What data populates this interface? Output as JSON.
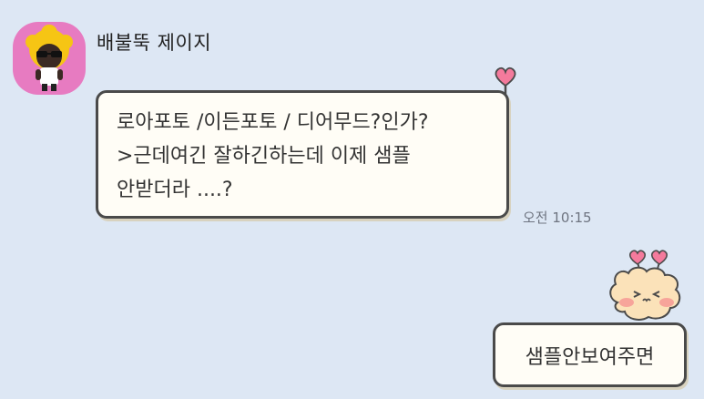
{
  "chat": {
    "sender_name": "배불뚝 제이지",
    "incoming_message": "로아포토 /이든포토 / 디어무드?인가?\n>근데여긴 잘하긴하는데 이제 샘플\n안받더라 ....?",
    "incoming_time": "오전 10:15",
    "outgoing_message": "샘플안보여주면"
  },
  "icons": {
    "avatar": "profile-avatar",
    "bubble_heart": "heart-icon",
    "sticker": "bear-sticker-icon"
  },
  "colors": {
    "background": "#dde7f4",
    "avatar_bg": "#e77bc1",
    "heart": "#f47a9c",
    "bubble_bg": "#fffdf6",
    "bubble_border": "#4a4a4a"
  }
}
